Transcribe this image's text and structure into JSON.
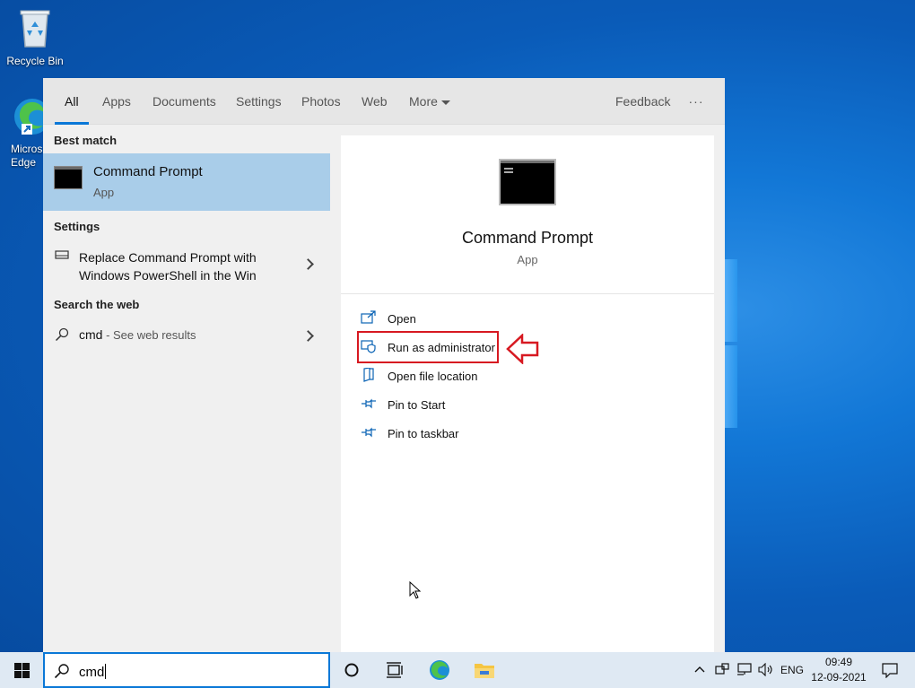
{
  "desktop": {
    "icons": [
      {
        "label": "Recycle Bin"
      },
      {
        "label": "Micros\nEdge"
      }
    ]
  },
  "search": {
    "tabs": [
      {
        "label": "All",
        "active": true
      },
      {
        "label": "Apps"
      },
      {
        "label": "Documents"
      },
      {
        "label": "Settings"
      },
      {
        "label": "Photos"
      },
      {
        "label": "Web"
      },
      {
        "label": "More"
      }
    ],
    "feedback_label": "Feedback",
    "more_options_icon": "ellipsis-icon",
    "sections": {
      "best_match": "Best match",
      "settings": "Settings",
      "search_web": "Search the web"
    },
    "best_match": {
      "title": "Command Prompt",
      "subtitle": "App"
    },
    "settings_item": {
      "line1": "Replace Command Prompt with",
      "line2": "Windows PowerShell in the Win"
    },
    "web_item": {
      "query": "cmd",
      "suffix": " - See web results"
    },
    "preview": {
      "title": "Command Prompt",
      "subtitle": "App",
      "actions": [
        {
          "label": "Open",
          "icon": "open-icon"
        },
        {
          "label": "Run as administrator",
          "icon": "shield-icon"
        },
        {
          "label": "Open file location",
          "icon": "file-location-icon"
        },
        {
          "label": "Pin to Start",
          "icon": "pin-icon"
        },
        {
          "label": "Pin to taskbar",
          "icon": "pin-icon"
        }
      ]
    },
    "highlight_color": "#d71921"
  },
  "taskbar": {
    "search_value": "cmd",
    "language": "ENG",
    "time": "09:49",
    "date": "12-09-2021",
    "accent": "#0a78d7"
  }
}
